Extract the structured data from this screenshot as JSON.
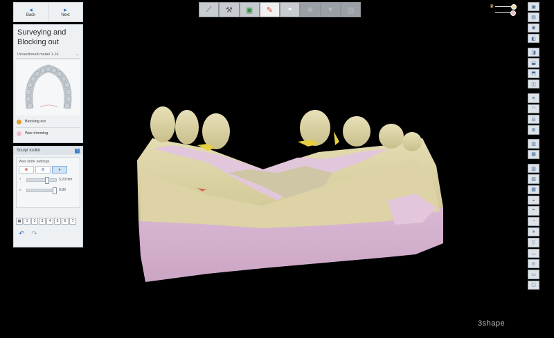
{
  "nav": {
    "back_label": "Back",
    "next_label": "Next"
  },
  "step": {
    "title": "Surveying and Blocking out",
    "model_selector": "Unsectioned model 1-16",
    "items": [
      {
        "label": "Blocking out",
        "color": "#e0a030"
      },
      {
        "label": "Wax trimming",
        "color": "#f0b8c8"
      }
    ]
  },
  "sculpt": {
    "header": "Sculpt toolkit",
    "help_icon": "?",
    "wax_settings_title": "Wax knife settings",
    "size_value": "3.20 mm",
    "strength_value": "0.90",
    "number_buttons": [
      "1",
      "2",
      "3",
      "4",
      "5",
      "6",
      "7"
    ]
  },
  "top_toolbar": [
    {
      "icon": "prepare-icon",
      "state": "normal"
    },
    {
      "icon": "tools-icon",
      "state": "normal"
    },
    {
      "icon": "model-icon",
      "state": "normal"
    },
    {
      "icon": "blockout-icon",
      "state": "active"
    },
    {
      "icon": "crown-icon",
      "state": "normal"
    },
    {
      "icon": "design-icon",
      "state": "disabled"
    },
    {
      "icon": "design2-icon",
      "state": "disabled"
    },
    {
      "icon": "save-icon",
      "state": "disabled"
    }
  ],
  "logo": "3shape",
  "colors": {
    "model_beige": "#d9d0a4",
    "wax_pink": "#e5c4de",
    "accent_blue": "#2a6fc0"
  }
}
